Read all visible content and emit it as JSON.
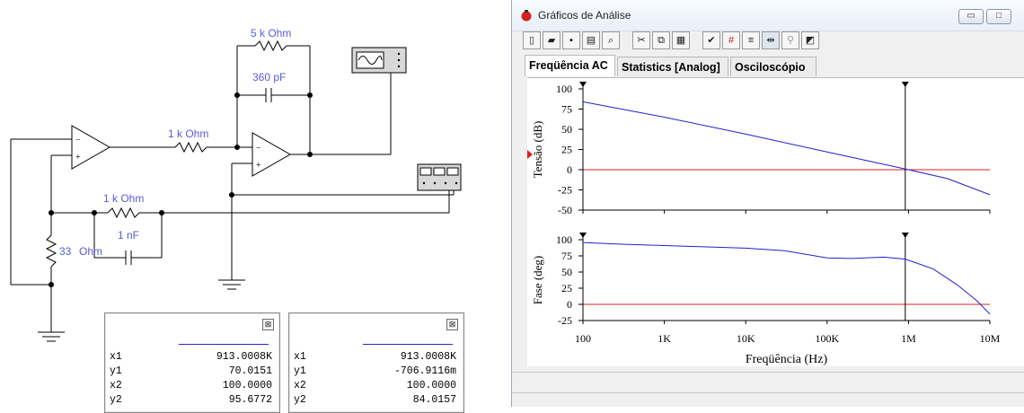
{
  "schematic": {
    "labels": {
      "r_feedback": "5 k Ohm",
      "c_feedback": "360 pF",
      "r_input": "1 k Ohm",
      "r_filter": "1 k Ohm",
      "c_filter": "1 nF",
      "r_ground": "33",
      "r_ground_unit": "Ohm"
    }
  },
  "readouts": [
    {
      "rows": [
        {
          "k": "x1",
          "v": "913.0008K"
        },
        {
          "k": "y1",
          "v": "70.0151"
        },
        {
          "k": "x2",
          "v": "100.0000"
        },
        {
          "k": "y2",
          "v": "95.6772"
        }
      ]
    },
    {
      "rows": [
        {
          "k": "x1",
          "v": "913.0008K"
        },
        {
          "k": "y1",
          "v": "-706.9116m"
        },
        {
          "k": "x2",
          "v": "100.0000"
        },
        {
          "k": "y2",
          "v": "84.0157"
        }
      ]
    }
  ],
  "window": {
    "title": "Gráficos de Análise",
    "buttons": {
      "minimize": "▭",
      "maximize": "□",
      "close": "✕"
    },
    "tabs": [
      "Freqüência AC",
      "Statistics [Analog]",
      "Osciloscópio"
    ],
    "active_tab": 0,
    "toolbar_icons": [
      "new-icon",
      "open-icon",
      "save-icon",
      "print-icon",
      "print-preview-icon",
      "cut-icon",
      "copy-icon",
      "paste-icon",
      "properties-icon",
      "grid-icon",
      "legend-icon",
      "cursors-icon",
      "zoom-icon",
      "reverse-colors-icon"
    ]
  },
  "chart_data": [
    {
      "type": "line",
      "ylabel": "Tensão (dB)",
      "xscale": "log",
      "xlim": [
        100,
        10000000
      ],
      "ylim": [
        -50,
        100
      ],
      "yticks": [
        100,
        75,
        50,
        25,
        0,
        -25,
        -50
      ],
      "reference_line": 0,
      "series": [
        {
          "x": [
            100,
            1000,
            10000,
            100000,
            1000000,
            3000000,
            10000000
          ],
          "y": [
            84,
            65,
            44,
            22,
            0,
            -11,
            -31
          ]
        }
      ],
      "cursors_x": [
        100,
        913000
      ]
    },
    {
      "type": "line",
      "ylabel": "Fase (deg)",
      "xlabel": "Freqüência (Hz)",
      "xscale": "log",
      "xlim": [
        100,
        10000000
      ],
      "ylim": [
        -25,
        100
      ],
      "yticks": [
        100,
        75,
        50,
        25,
        0,
        -25
      ],
      "xticklabels": [
        "100",
        "1K",
        "10K",
        "100K",
        "1M",
        "10M"
      ],
      "reference_line": 0,
      "series": [
        {
          "x": [
            100,
            300,
            1000,
            3000,
            10000,
            30000,
            100000,
            200000,
            500000,
            913000,
            2000000,
            4000000,
            7000000,
            10000000
          ],
          "y": [
            95.7,
            93,
            91,
            89,
            87,
            83,
            72,
            71,
            73,
            70,
            55,
            30,
            5,
            -15
          ]
        }
      ],
      "cursors_x": [
        100,
        913000
      ]
    }
  ],
  "colors": {
    "trace": "#2020d0",
    "reference": "#e02020",
    "label": "#5a5ad8"
  }
}
